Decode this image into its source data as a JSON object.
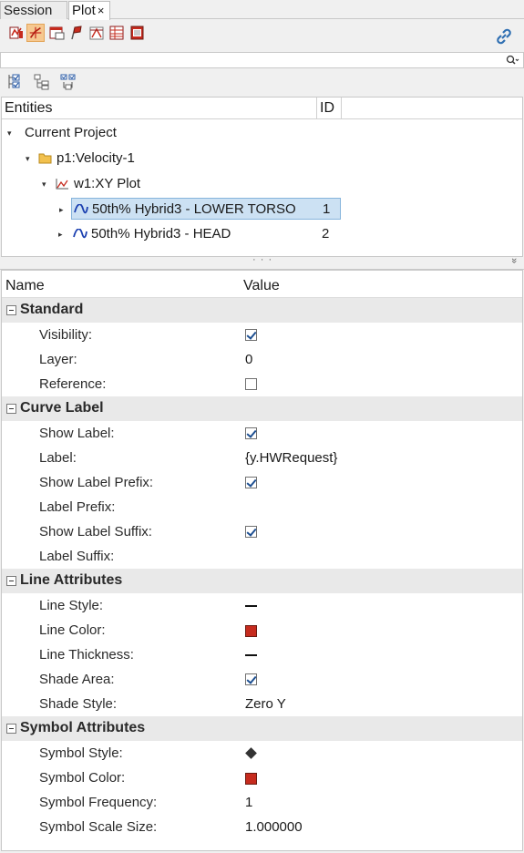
{
  "tabs": [
    {
      "label": "Session",
      "active": false
    },
    {
      "label": "Plot",
      "active": true,
      "close": "×"
    }
  ],
  "toolbar": {
    "icons": [
      "plot-browser-icon",
      "curve-tool-icon",
      "window-icon",
      "note-icon",
      "datum-icon",
      "table-icon",
      "print-icon"
    ],
    "link_icon": "link-icon"
  },
  "search": {
    "value": "",
    "placeholder": ""
  },
  "tree_toolbar": {
    "icons": [
      "expand-all-icon",
      "tree-view-icon",
      "sync-icon"
    ]
  },
  "entities": {
    "header": {
      "name": "Entities",
      "id": "ID"
    },
    "rows": [
      {
        "label": "Current Project",
        "id": "",
        "level": 0,
        "icon": "",
        "selected": false
      },
      {
        "label": "p1:Velocity-1",
        "id": "",
        "level": 1,
        "icon": "folder-icon",
        "selected": false
      },
      {
        "label": "w1:XY Plot",
        "id": "",
        "level": 2,
        "icon": "xy-plot-icon",
        "selected": false
      },
      {
        "label": "50th% Hybrid3   - LOWER TORSO",
        "id": "1",
        "level": 3,
        "icon": "curve-icon",
        "selected": true
      },
      {
        "label": "50th% Hybrid3   - HEAD",
        "id": "2",
        "level": 3,
        "icon": "curve-icon",
        "selected": false
      }
    ]
  },
  "splitter": {
    "dots": "· · ·",
    "collapse": "»"
  },
  "properties": {
    "header": {
      "name": "Name",
      "value": "Value"
    },
    "groups": [
      {
        "title": "Standard",
        "rows": [
          {
            "name": "Visibility:",
            "type": "checkbox",
            "checked": true
          },
          {
            "name": "Layer:",
            "type": "text",
            "value": "0"
          },
          {
            "name": "Reference:",
            "type": "checkbox",
            "checked": false
          }
        ]
      },
      {
        "title": "Curve Label",
        "rows": [
          {
            "name": "Show Label:",
            "type": "checkbox",
            "checked": true
          },
          {
            "name": "Label:",
            "type": "text",
            "value": "{y.HWRequest}"
          },
          {
            "name": "Show Label Prefix:",
            "type": "checkbox",
            "checked": true
          },
          {
            "name": "Label Prefix:",
            "type": "text",
            "value": ""
          },
          {
            "name": "Show Label Suffix:",
            "type": "checkbox",
            "checked": true
          },
          {
            "name": "Label Suffix:",
            "type": "text",
            "value": ""
          }
        ]
      },
      {
        "title": "Line Attributes",
        "rows": [
          {
            "name": "Line Style:",
            "type": "line"
          },
          {
            "name": "Line Color:",
            "type": "color",
            "color": "#c62b1e"
          },
          {
            "name": "Line Thickness:",
            "type": "line"
          },
          {
            "name": "Shade Area:",
            "type": "checkbox",
            "checked": true
          },
          {
            "name": "Shade Style:",
            "type": "text",
            "value": "Zero Y"
          }
        ]
      },
      {
        "title": "Symbol Attributes",
        "rows": [
          {
            "name": "Symbol Style:",
            "type": "diamond"
          },
          {
            "name": "Symbol Color:",
            "type": "color",
            "color": "#c62b1e"
          },
          {
            "name": "Symbol Frequency:",
            "type": "text",
            "value": "1"
          },
          {
            "name": "Symbol Scale Size:",
            "type": "text",
            "value": "1.000000"
          }
        ]
      }
    ]
  },
  "colors": {
    "accent": "#f6c890",
    "selection": "#cce1f3",
    "curve": "#1a3fb0",
    "red": "#c62b1e"
  }
}
